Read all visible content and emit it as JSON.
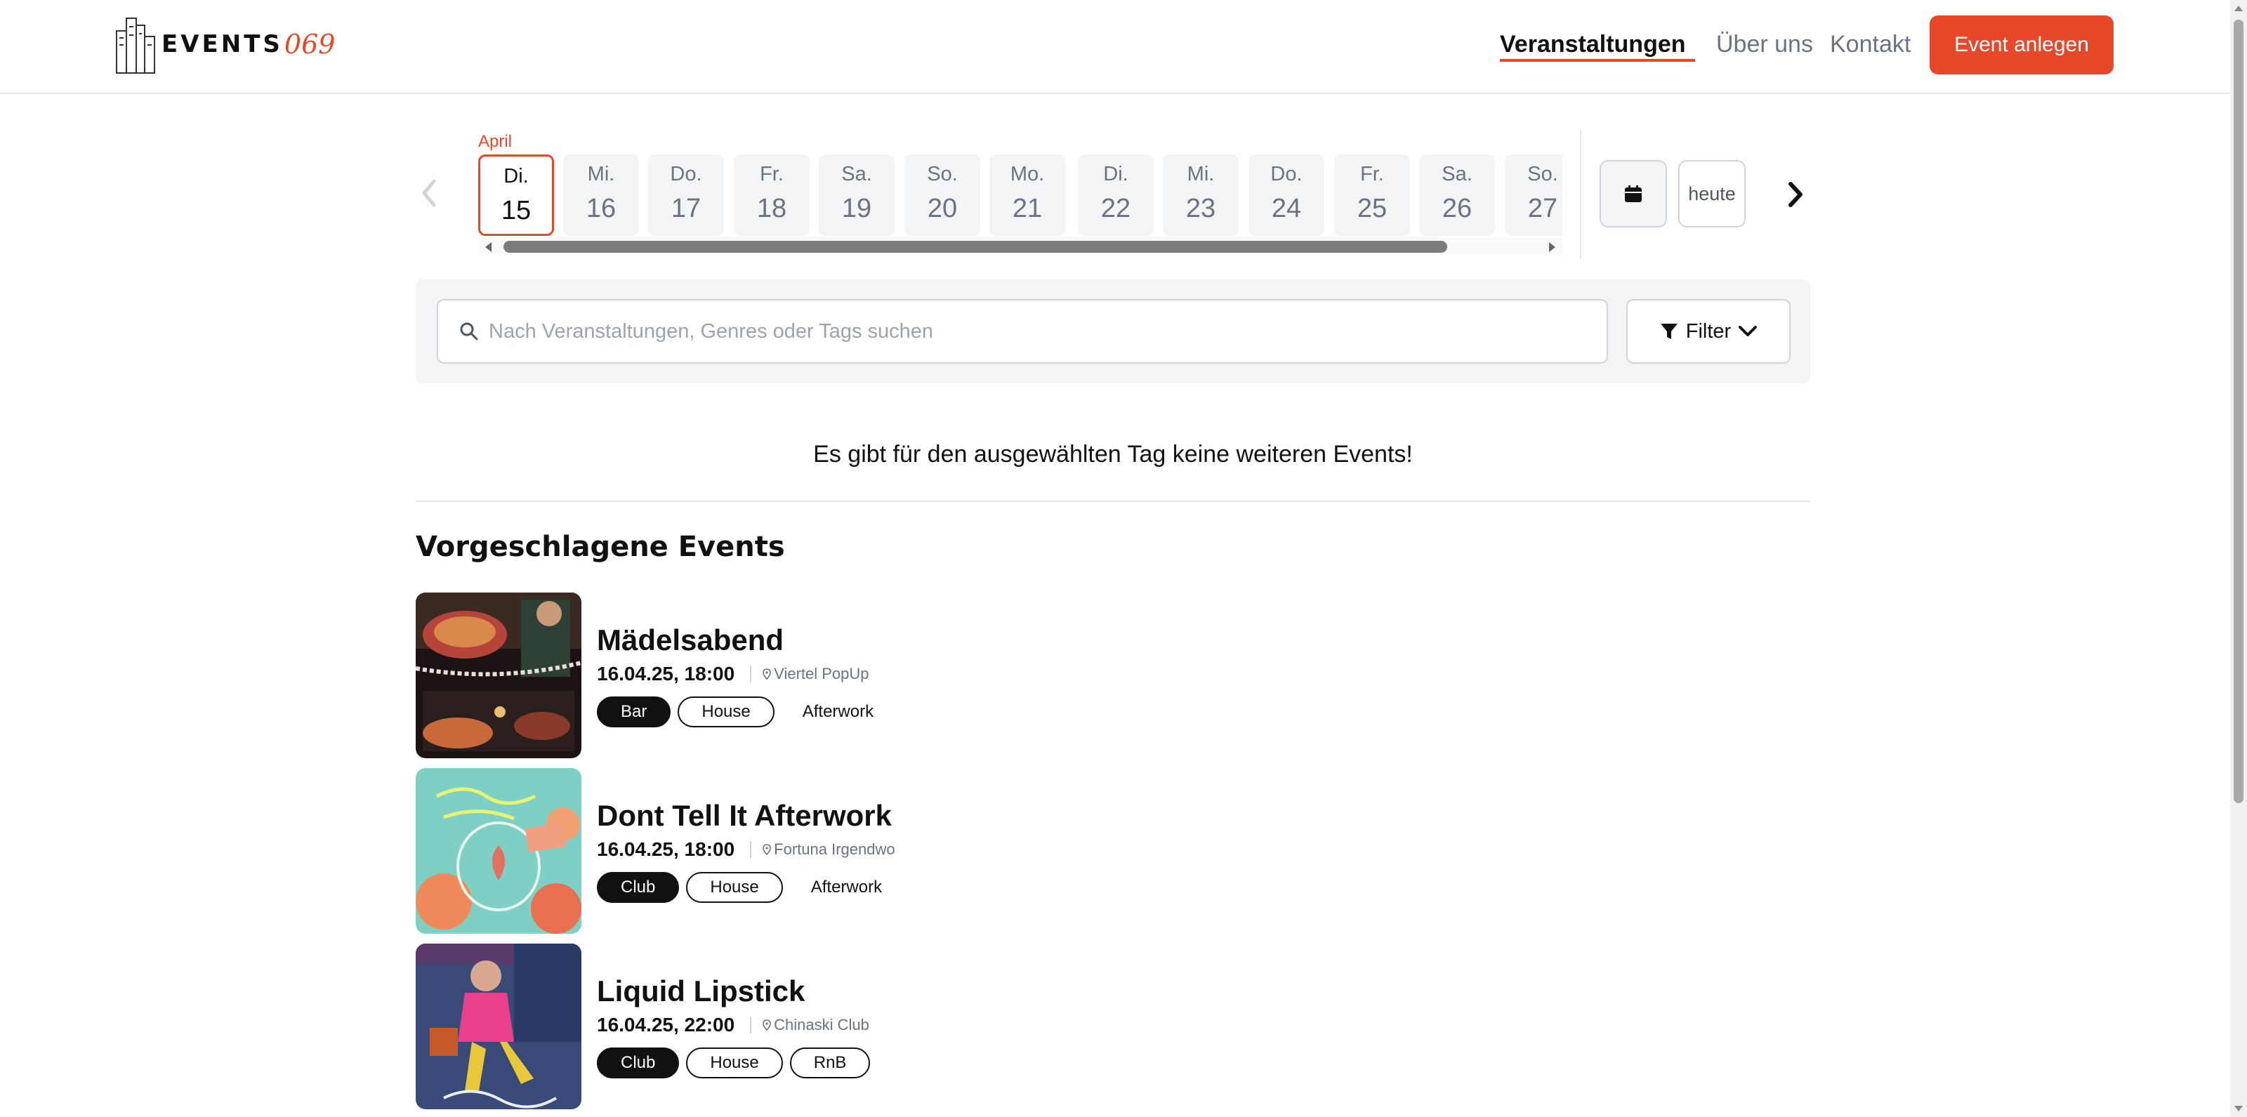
{
  "header": {
    "logo_text": "EVENTS",
    "logo_script": "069",
    "nav": [
      {
        "label": "Veranstaltungen",
        "active": true
      },
      {
        "label": "Über uns",
        "active": false
      },
      {
        "label": "Kontakt",
        "active": false
      }
    ],
    "cta_label": "Event anlegen"
  },
  "calendar": {
    "month": "April",
    "today_label": "heute",
    "days": [
      {
        "dow": "Di.",
        "dom": "15",
        "selected": true
      },
      {
        "dow": "Mi.",
        "dom": "16"
      },
      {
        "dow": "Do.",
        "dom": "17"
      },
      {
        "dow": "Fr.",
        "dom": "18"
      },
      {
        "dow": "Sa.",
        "dom": "19"
      },
      {
        "dow": "So.",
        "dom": "20"
      },
      {
        "dow": "Mo.",
        "dom": "21"
      },
      {
        "dow": "Di.",
        "dom": "22"
      },
      {
        "dow": "Mi.",
        "dom": "23"
      },
      {
        "dow": "Do.",
        "dom": "24"
      },
      {
        "dow": "Fr.",
        "dom": "25"
      },
      {
        "dow": "Sa.",
        "dom": "26"
      },
      {
        "dow": "So.",
        "dom": "27"
      }
    ]
  },
  "search": {
    "placeholder": "Nach Veranstaltungen, Genres oder Tags suchen",
    "value": "",
    "filter_label": "Filter"
  },
  "messages": {
    "no_events": "Es gibt für den ausgewählten Tag keine weiteren Events!"
  },
  "suggested": {
    "title": "Vorgeschlagene Events",
    "events": [
      {
        "title": "Mädelsabend",
        "datetime": "16.04.25, 18:00",
        "location": "Viertel PopUp",
        "tags": [
          {
            "label": "Bar",
            "style": "filled"
          },
          {
            "label": "House",
            "style": "outline"
          },
          {
            "label": "Afterwork",
            "style": "plain"
          }
        ]
      },
      {
        "title": "Dont Tell It Afterwork",
        "datetime": "16.04.25, 18:00",
        "location": "Fortuna Irgendwo",
        "tags": [
          {
            "label": "Club",
            "style": "filled"
          },
          {
            "label": "House",
            "style": "outline"
          },
          {
            "label": "Afterwork",
            "style": "plain"
          }
        ]
      },
      {
        "title": "Liquid Lipstick",
        "datetime": "16.04.25, 22:00",
        "location": "Chinaski Club",
        "tags": [
          {
            "label": "Club",
            "style": "filled"
          },
          {
            "label": "House",
            "style": "outline"
          },
          {
            "label": "RnB",
            "style": "outline"
          }
        ]
      }
    ]
  },
  "colors": {
    "accent": "#e8482a",
    "muted": "#6b7280",
    "card_bg": "#f3f4f6"
  }
}
